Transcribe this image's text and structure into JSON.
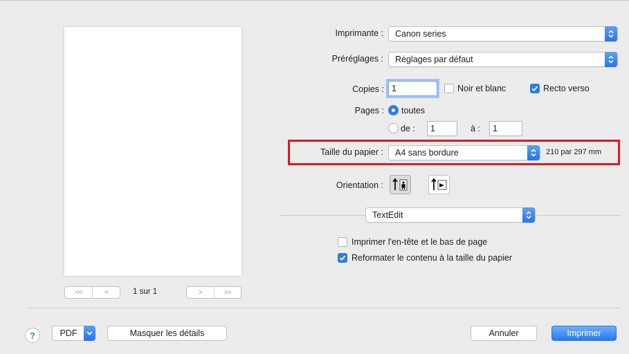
{
  "preview": {
    "first_icon": "double-left-arrows",
    "prev_icon": "left-arrow",
    "next_icon": "right-arrow",
    "last_icon": "double-right-arrows",
    "counter": "1 sur 1"
  },
  "printer": {
    "label": "Imprimante :",
    "value": "Canon         series"
  },
  "presets": {
    "label": "Préréglages :",
    "value": "Réglages par défaut"
  },
  "copies": {
    "label": "Copies :",
    "value": "1"
  },
  "bw": {
    "label": "Noir et blanc",
    "checked": false
  },
  "duplex": {
    "label": "Recto verso",
    "checked": true
  },
  "pages": {
    "label": "Pages :",
    "all_label": "toutes",
    "from_label": "de :",
    "from_value": "1",
    "to_label": "à :",
    "to_value": "1"
  },
  "paper_size": {
    "label": "Taille du papier :",
    "value": "A4 sans bordure",
    "dimensions": "210 par 297 mm"
  },
  "orientation": {
    "label": "Orientation :"
  },
  "app_section": {
    "value": "TextEdit"
  },
  "options": {
    "header_footer": {
      "label": "Imprimer l'en-tête et le bas de page",
      "checked": false
    },
    "rewrap": {
      "label": "Reformater le contenu à la taille du papier",
      "checked": true
    }
  },
  "footer": {
    "help": "?",
    "pdf": "PDF",
    "hide_details": "Masquer les détails",
    "cancel": "Annuler",
    "print": "Imprimer"
  },
  "colors": {
    "accent": "#2f7be9",
    "highlight": "#e8141a"
  }
}
